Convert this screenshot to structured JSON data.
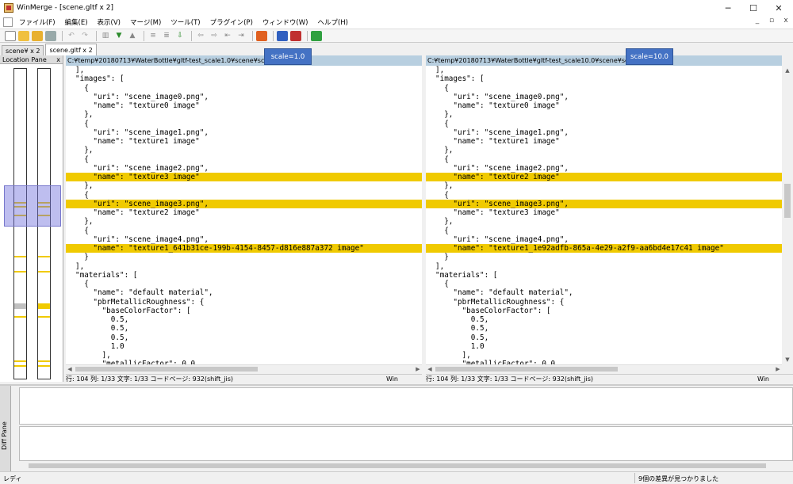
{
  "window": {
    "title": "WinMerge - [scene.gltf x 2]",
    "minimize": "─",
    "maximize": "☐",
    "close": "✕"
  },
  "menu": {
    "items": [
      "ファイル(F)",
      "編集(E)",
      "表示(V)",
      "マージ(M)",
      "ツール(T)",
      "プラグイン(P)",
      "ウィンドウ(W)",
      "ヘルプ(H)"
    ],
    "mdi_min": "_",
    "mdi_restore": "▫",
    "mdi_close": "x"
  },
  "tabs": [
    {
      "label": "scene¥ x 2"
    },
    {
      "label": "scene.gltf x 2"
    }
  ],
  "location_pane": {
    "title": "Location Pane",
    "close": "x"
  },
  "left": {
    "path": "C:¥temp¥20180713¥WaterBottle¥gltf-test_scale1.0¥scene¥scene.gltf",
    "badge": "scale=1.0",
    "lines": [
      "],",
      "\"images\": [",
      "  {",
      "    \"uri\": \"scene_image0.png\",",
      "    \"name\": \"texture0 image\"",
      "  },",
      "  {",
      "    \"uri\": \"scene_image1.png\",",
      "    \"name\": \"texture1 image\"",
      "  },",
      "  {",
      "    \"uri\": \"scene_image2.png\",",
      "    \"name\": \"texture3 image\"",
      "  },",
      "  {",
      "    \"uri\": \"scene_image3.png\",",
      "    \"name\": \"texture2 image\"",
      "  },",
      "  {",
      "    \"uri\": \"scene_image4.png\",",
      "    \"name\": \"texture1_641b31ce-199b-4154-8457-d816e887a372 image\"",
      "  }",
      "],",
      "\"materials\": [",
      "  {",
      "    \"name\": \"default material\",",
      "    \"pbrMetallicRoughness\": {",
      "      \"baseColorFactor\": [",
      "        0.5,",
      "        0.5,",
      "        0.5,",
      "        1.0",
      "      ],",
      "      \"metallicFactor\": 0.0,"
    ],
    "status": "行: 104  列: 1/33  文字: 1/33  コードページ: 932(shift_jis)",
    "eol": "Win"
  },
  "right": {
    "path": "C:¥temp¥20180713¥WaterBottle¥gltf-test_scale10.0¥scene¥scene.gltf",
    "badge": "scale=10.0",
    "lines": [
      "],",
      "\"images\": [",
      "  {",
      "    \"uri\": \"scene_image0.png\",",
      "    \"name\": \"texture0 image\"",
      "  },",
      "  {",
      "    \"uri\": \"scene_image1.png\",",
      "    \"name\": \"texture1 image\"",
      "  },",
      "  {",
      "    \"uri\": \"scene_image2.png\",",
      "    \"name\": \"texture2 image\"",
      "  },",
      "  {",
      "    \"uri\": \"scene_image3.png\",",
      "    \"name\": \"texture3 image\"",
      "  },",
      "  {",
      "    \"uri\": \"scene_image4.png\",",
      "    \"name\": \"texture1_1e92adfb-865a-4e29-a2f9-aa6bd4e17c41 image\"",
      "  }",
      "],",
      "\"materials\": [",
      "  {",
      "    \"name\": \"default material\",",
      "    \"pbrMetallicRoughness\": {",
      "      \"baseColorFactor\": [",
      "        0.5,",
      "        0.5,",
      "        0.5,",
      "        1.0",
      "      ],",
      "      \"metallicFactor\": 0.0,"
    ],
    "status": "行: 104  列: 1/33  文字: 1/33  コードページ: 932(shift_jis)",
    "eol": "Win"
  },
  "diff_lines": [
    12,
    15,
    20
  ],
  "diff_pane": {
    "title": "Diff Pane"
  },
  "statusbar": {
    "left": "レディ",
    "right": "9個の差異が見つかりました"
  },
  "colors": {
    "diff": "#f0ca00",
    "badge": "#4472c4",
    "header": "#b8cfe0"
  }
}
